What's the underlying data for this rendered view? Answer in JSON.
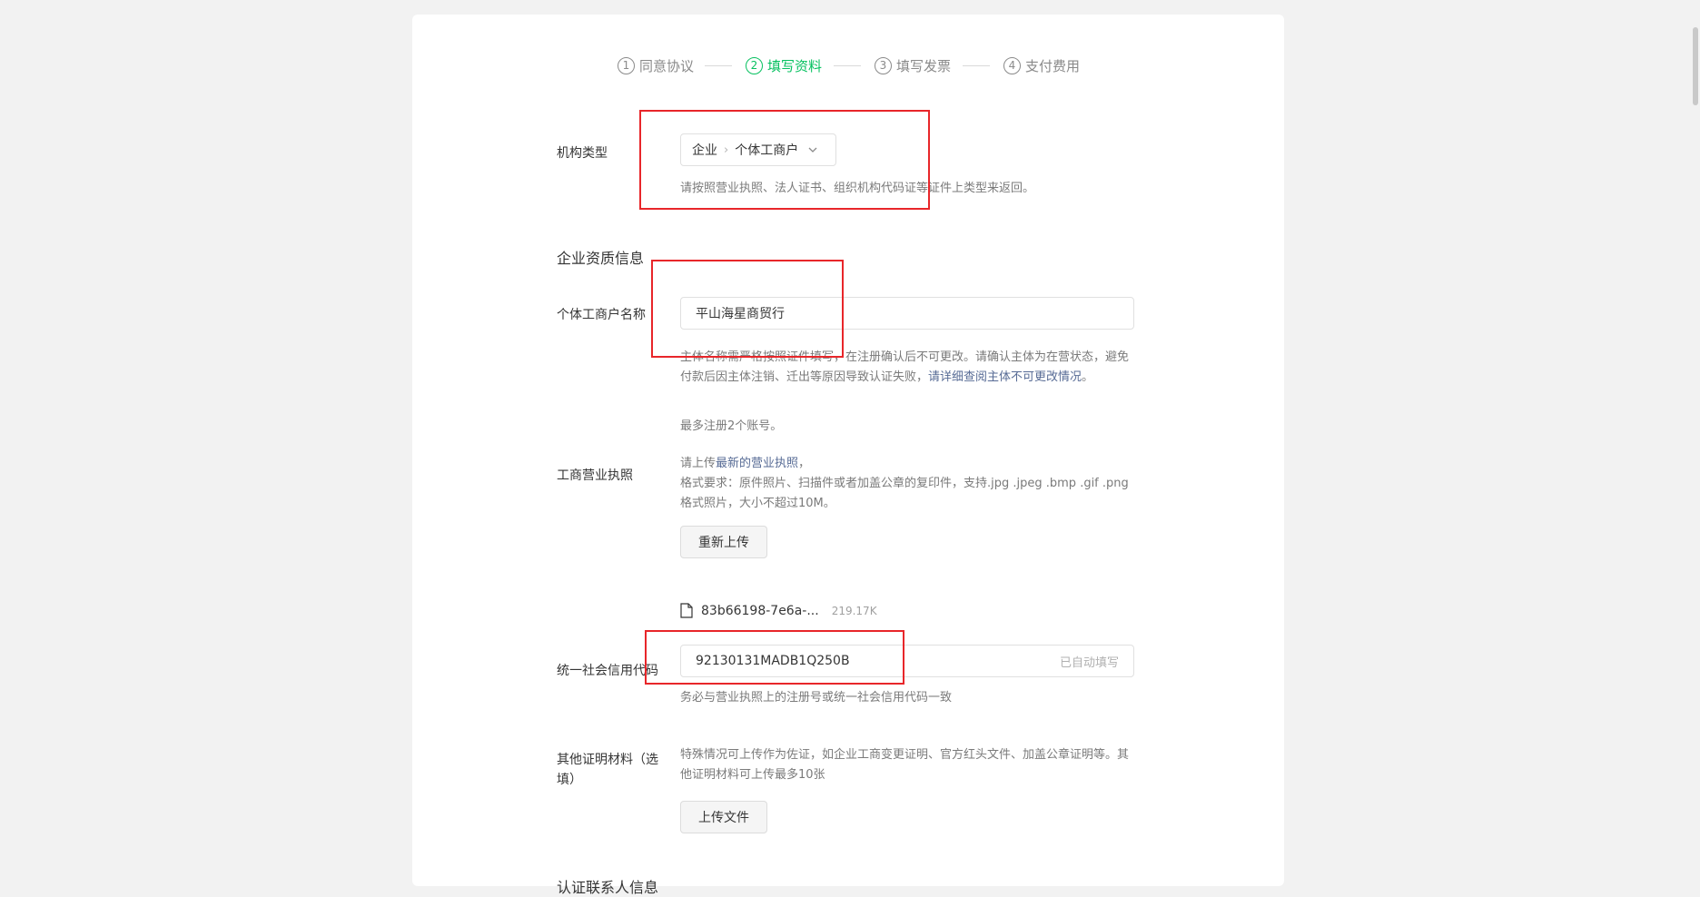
{
  "steps": [
    {
      "num": "1",
      "label": "同意协议",
      "active": false
    },
    {
      "num": "2",
      "label": "填写资料",
      "active": true
    },
    {
      "num": "3",
      "label": "填写发票",
      "active": false
    },
    {
      "num": "4",
      "label": "支付费用",
      "active": false
    }
  ],
  "org_type": {
    "label": "机构类型",
    "value_main": "企业",
    "value_sub": "个体工商户",
    "hint": "请按照营业执照、法人证书、组织机构代码证等证件上类型来返回。"
  },
  "qualification_section": {
    "title": "企业资质信息"
  },
  "business_name": {
    "label": "个体工商户名称",
    "value": "平山海星商贸行",
    "hint_prefix": "主体名称需严格按照证件填写，在注册确认后不可更改。请确认主体为在营状态，避免付款后因主体注销、迁出等原因导致认证失败，",
    "hint_link": "请详细查阅主体不可更改情况",
    "hint_suffix": "。",
    "limit_note": "最多注册2个账号。"
  },
  "license": {
    "label": "工商营业执照",
    "hint_prefix": "请上传",
    "hint_link": "最新的营业执照",
    "hint_suffix": "，",
    "format_note": "格式要求：原件照片、扫描件或者加盖公章的复印件，支持.jpg .jpeg .bmp .gif .png格式照片，大小不超过10M。",
    "reupload_label": "重新上传",
    "file_name": "83b66198-7e6a-...",
    "file_size": "219.17K"
  },
  "credit_code": {
    "label": "统一社会信用代码",
    "value": "92130131MADB1Q250B",
    "suffix": "已自动填写",
    "hint": "务必与营业执照上的注册号或统一社会信用代码一致"
  },
  "other_docs": {
    "label": "其他证明材料（选填）",
    "hint": "特殊情况可上传作为佐证，如企业工商变更证明、官方红头文件、加盖公章证明等。其他证明材料可上传最多10张",
    "upload_label": "上传文件"
  },
  "contact_section": {
    "title": "认证联系人信息"
  }
}
